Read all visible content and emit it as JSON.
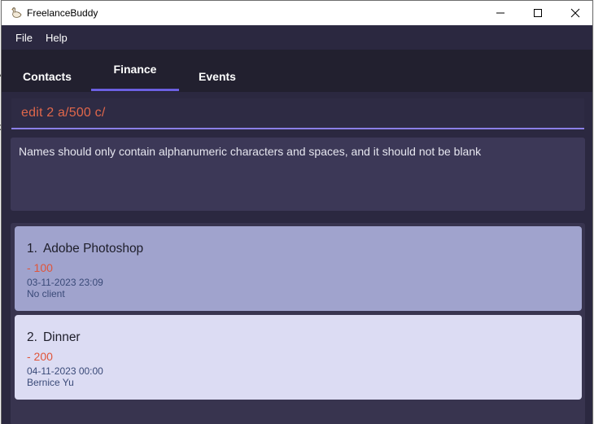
{
  "window": {
    "title": "FreelanceBuddy",
    "icon": "goose-logo-icon"
  },
  "menu": {
    "items": [
      {
        "label": "File"
      },
      {
        "label": "Help"
      }
    ]
  },
  "tabs": [
    {
      "label": "Contacts",
      "active": false
    },
    {
      "label": "Finance",
      "active": true
    },
    {
      "label": "Events",
      "active": false
    }
  ],
  "command": {
    "value": "edit 2 a/500 c/"
  },
  "result": {
    "message": "Names should only contain alphanumeric characters and spaces, and it should not be blank"
  },
  "finances": [
    {
      "index": "1.",
      "name": "Adobe Photoshop",
      "amount": "- 100",
      "datetime": "03-11-2023 23:09",
      "client": "No client",
      "selected": true
    },
    {
      "index": "2.",
      "name": "Dinner",
      "amount": "- 200",
      "datetime": "04-11-2023 00:00",
      "client": "Bernice Yu",
      "selected": false
    }
  ],
  "colors": {
    "background": "#2b2840",
    "tabbar": "#22202f",
    "accent": "#6b5fe0",
    "command_text": "#e0674b",
    "amount": "#e0553a",
    "card_selected": "#a0a3cd",
    "card_default": "#dcdcf3"
  }
}
